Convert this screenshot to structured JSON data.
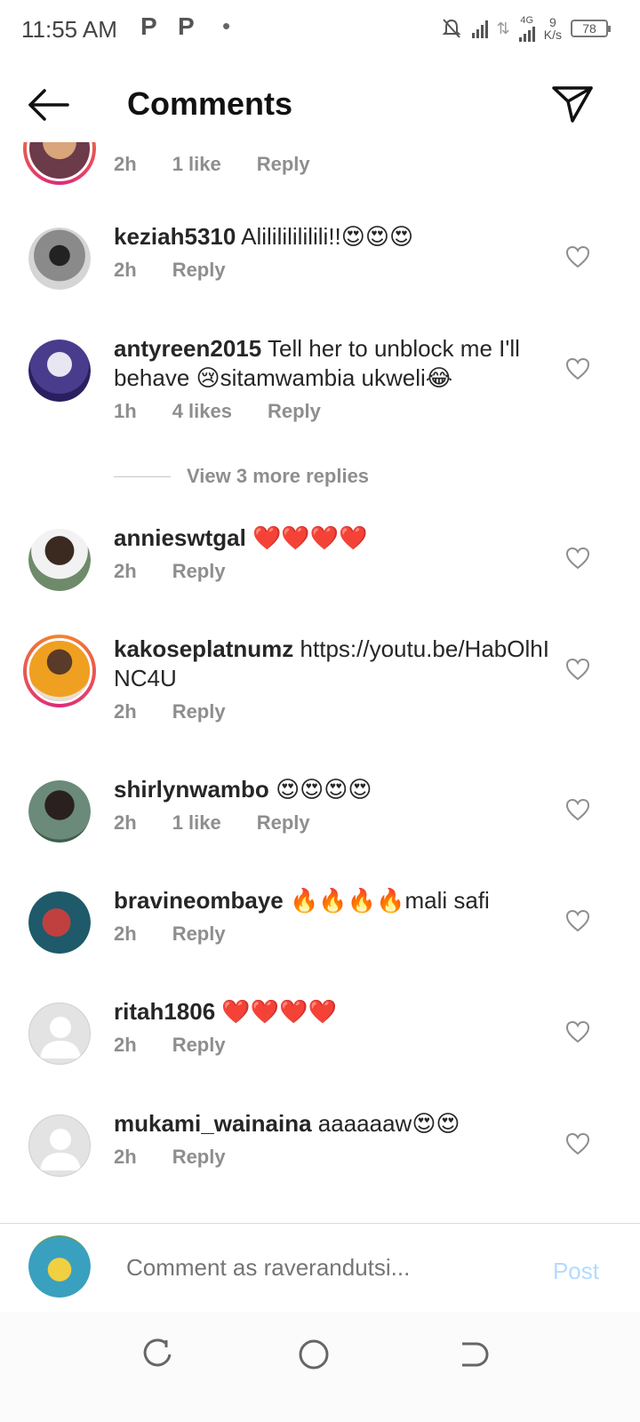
{
  "status": {
    "time": "11:55 AM",
    "notif_icons": [
      "P",
      "P"
    ],
    "network": "4G",
    "speed_value": "9",
    "speed_unit": "K/s",
    "battery": "78"
  },
  "header": {
    "title": "Comments"
  },
  "top_partial": {
    "time": "2h",
    "likes": "1 like",
    "reply": "Reply"
  },
  "comments": [
    {
      "user": "keziah5310",
      "text": "Alilililililili!!😍😍😍",
      "time": "2h",
      "likes": "",
      "reply": "Reply"
    },
    {
      "user": "antyreen2015",
      "text": "Tell her to unblock me I'll behave 😢sitamwambia ukweli😂",
      "time": "1h",
      "likes": "4 likes",
      "reply": "Reply"
    },
    {
      "user": "annieswtgal",
      "text": "❤️❤️❤️❤️",
      "time": "2h",
      "likes": "",
      "reply": "Reply"
    },
    {
      "user": "kakoseplatnumz",
      "text": "https://youtu.be/HabOlhINC4U",
      "time": "2h",
      "likes": "",
      "reply": "Reply"
    },
    {
      "user": "shirlynwambo",
      "text": "😍😍😍😍",
      "time": "2h",
      "likes": "1 like",
      "reply": "Reply"
    },
    {
      "user": "bravineombaye",
      "text": "🔥🔥🔥🔥mali safi",
      "time": "2h",
      "likes": "",
      "reply": "Reply"
    },
    {
      "user": "ritah1806",
      "text": "❤️❤️❤️❤️",
      "time": "2h",
      "likes": "",
      "reply": "Reply"
    },
    {
      "user": "mukami_wainaina",
      "text": "aaaaaaw😍😍",
      "time": "2h",
      "likes": "",
      "reply": "Reply"
    }
  ],
  "view_replies": "View 3 more replies",
  "composer": {
    "placeholder": "Comment as raverandutsi...",
    "post_label": "Post"
  },
  "colors": {
    "accent_disabled": "#b3dbff",
    "meta_gray": "#8e8e8e",
    "story_ring": "#dd2a7b"
  }
}
